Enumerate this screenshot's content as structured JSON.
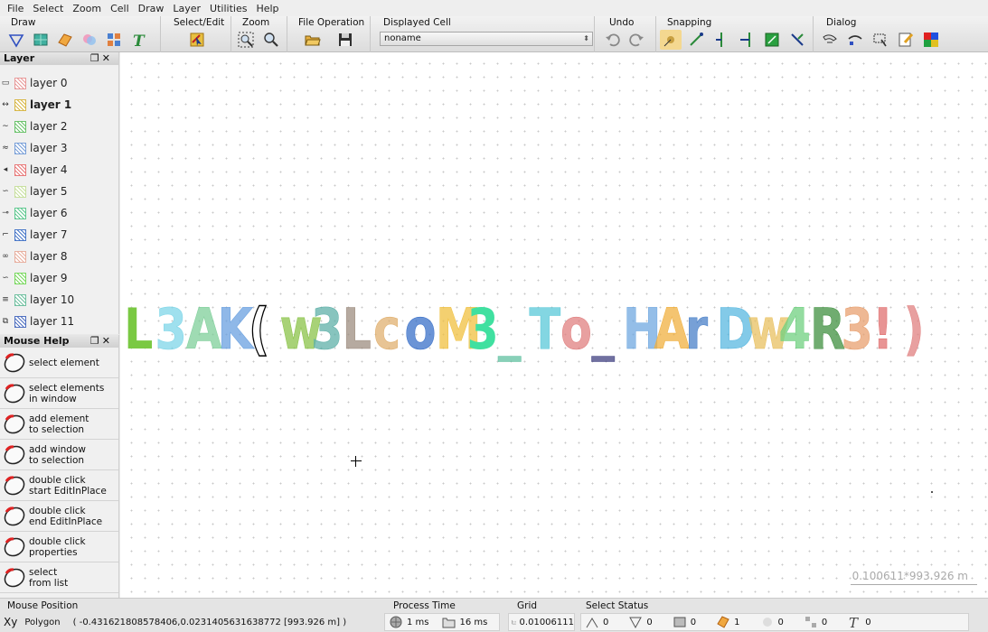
{
  "menu": [
    "File",
    "Select",
    "Zoom",
    "Cell",
    "Draw",
    "Layer",
    "Utilities",
    "Help"
  ],
  "toolbar": {
    "draw_label": "Draw",
    "select_label": "Select/Edit",
    "zoom_label": "Zoom",
    "file_label": "File Operation",
    "cell_label": "Displayed Cell",
    "cell_value": "noname",
    "undo_label": "Undo",
    "snap_label": "Snapping",
    "dialog_label": "Dialog"
  },
  "layer_panel": {
    "title": "Layer",
    "layers": [
      {
        "label": "layer 0",
        "color": "#e89a9a"
      },
      {
        "label": "layer 1",
        "color": "#d8b84a"
      },
      {
        "label": "layer 2",
        "color": "#6cc36c"
      },
      {
        "label": "layer 3",
        "color": "#7aa0d8"
      },
      {
        "label": "layer 4",
        "color": "#e87a7a"
      },
      {
        "label": "layer 5",
        "color": "#c8e0a0"
      },
      {
        "label": "layer 6",
        "color": "#60c890"
      },
      {
        "label": "layer 7",
        "color": "#4a78c8"
      },
      {
        "label": "layer 8",
        "color": "#e8b0a0"
      },
      {
        "label": "layer 9",
        "color": "#7ad860"
      },
      {
        "label": "layer 10",
        "color": "#70c0a0"
      },
      {
        "label": "layer 11",
        "color": "#5070c0"
      }
    ]
  },
  "help_panel": {
    "title": "Mouse Help",
    "items": [
      {
        "line1": "select element",
        "line2": ""
      },
      {
        "line1": "select elements",
        "line2": "in window"
      },
      {
        "line1": "add element",
        "line2": "to selection"
      },
      {
        "line1": "add window",
        "line2": "to selection"
      },
      {
        "line1": "double click",
        "line2": "start EditInPlace"
      },
      {
        "line1": "double click",
        "line2": "end EditInPlace"
      },
      {
        "line1": "double click",
        "line2": "properties"
      },
      {
        "line1": "select",
        "line2": "from list"
      }
    ]
  },
  "canvas": {
    "scale_text": "0.100611*993.926 m",
    "glyphs": [
      {
        "ch": "L",
        "color": "#7ac943",
        "fill": "solid"
      },
      {
        "ch": "3",
        "color": "#7fd6e8",
        "fill": "hatch"
      },
      {
        "ch": "A",
        "color": "#7fcf9a",
        "fill": "hatch"
      },
      {
        "ch": "K",
        "color": "#6aa0e0",
        "fill": "hatch"
      },
      {
        "ch": "(",
        "color": "#000000",
        "fill": "outline"
      },
      {
        "ch": "w",
        "color": "#8bc34a",
        "fill": "hatch"
      },
      {
        "ch": "3",
        "color": "#5fb0a8",
        "fill": "hatch"
      },
      {
        "ch": "L",
        "color": "#9e8e80",
        "fill": "hatch"
      },
      {
        "ch": "c",
        "color": "#e0b070",
        "fill": "hatch"
      },
      {
        "ch": "o",
        "color": "#3a70c8",
        "fill": "hatch"
      },
      {
        "ch": "M",
        "color": "#f0c040",
        "fill": "hatch"
      },
      {
        "ch": "3",
        "color": "#40e0a0",
        "fill": "solid"
      },
      {
        "ch": "_",
        "color": "#60c0a0",
        "fill": "hatch"
      },
      {
        "ch": "T",
        "color": "#5ac8d8",
        "fill": "hatch"
      },
      {
        "ch": "o",
        "color": "#e08080",
        "fill": "hatch"
      },
      {
        "ch": "_",
        "color": "#404080",
        "fill": "hatch"
      },
      {
        "ch": "H",
        "color": "#70a8e0",
        "fill": "hatch"
      },
      {
        "ch": "A",
        "color": "#f0b040",
        "fill": "hatch"
      },
      {
        "ch": "r",
        "color": "#4a80c8",
        "fill": "hatch"
      },
      {
        "ch": "D",
        "color": "#5ab8e0",
        "fill": "hatch"
      },
      {
        "ch": "w",
        "color": "#e8c060",
        "fill": "hatch"
      },
      {
        "ch": "4",
        "color": "#70d080",
        "fill": "hatch"
      },
      {
        "ch": "R",
        "color": "#409040",
        "fill": "hatch"
      },
      {
        "ch": "3",
        "color": "#e8a070",
        "fill": "hatch"
      },
      {
        "ch": "!",
        "color": "#e07070",
        "fill": "hatch"
      },
      {
        "ch": ")",
        "color": "#e08080",
        "fill": "hatch"
      }
    ]
  },
  "status": {
    "mouse_label": "Mouse Position",
    "mouse_type": "Polygon",
    "mouse_value": "( -0.431621808578406,0.0231405631638772 [993.926 m] )",
    "process_label": "Process Time",
    "process_a": "1 ms",
    "process_b": "16 ms",
    "grid_label": "Grid",
    "grid_value": "0.01006111",
    "select_label": "Select Status",
    "select_values": [
      "0",
      "0",
      "0",
      "1",
      "0",
      "0",
      "0"
    ]
  }
}
